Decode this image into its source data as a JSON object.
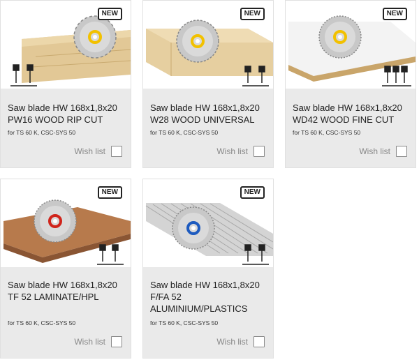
{
  "products": [
    {
      "badge": "NEW",
      "title_line1": "Saw blade HW 168x1,8x20",
      "title_line2": "PW16 WOOD RIP CUT",
      "title_line3": "",
      "compat": "for TS 60 K, CSC-SYS 50",
      "wish_label": "Wish list",
      "image": "saw-blade-rip-cut-on-wood-plank",
      "hub_color": "#f2c100"
    },
    {
      "badge": "NEW",
      "title_line1": "Saw blade HW 168x1,8x20",
      "title_line2": "W28 WOOD UNIVERSAL",
      "title_line3": "",
      "compat": "for TS 60 K, CSC-SYS 50",
      "wish_label": "Wish list",
      "image": "saw-blade-universal-on-wood-plank",
      "hub_color": "#f2c100"
    },
    {
      "badge": "NEW",
      "title_line1": "Saw blade HW 168x1,8x20",
      "title_line2": "WD42 WOOD FINE CUT",
      "title_line3": "",
      "compat": "for TS 60 K, CSC-SYS 50",
      "wish_label": "Wish list",
      "image": "saw-blade-fine-cut-on-coated-board",
      "hub_color": "#f2c100"
    },
    {
      "badge": "NEW",
      "title_line1": "Saw blade HW 168x1,8x20",
      "title_line2": "TF 52 LAMINATE/HPL",
      "title_line3": "",
      "compat": "for TS 60 K, CSC-SYS 50",
      "wish_label": "Wish list",
      "image": "saw-blade-laminate-on-board",
      "hub_color": "#d0241b"
    },
    {
      "badge": "NEW",
      "title_line1": "Saw blade HW 168x1,8x20",
      "title_line2": "F/FA 52",
      "title_line3": "ALUMINIUM/PLASTICS",
      "compat": "for TS 60 K, CSC-SYS 50",
      "wish_label": "Wish list",
      "image": "saw-blade-aluminium-profiles",
      "hub_color": "#1e5bbf"
    }
  ]
}
